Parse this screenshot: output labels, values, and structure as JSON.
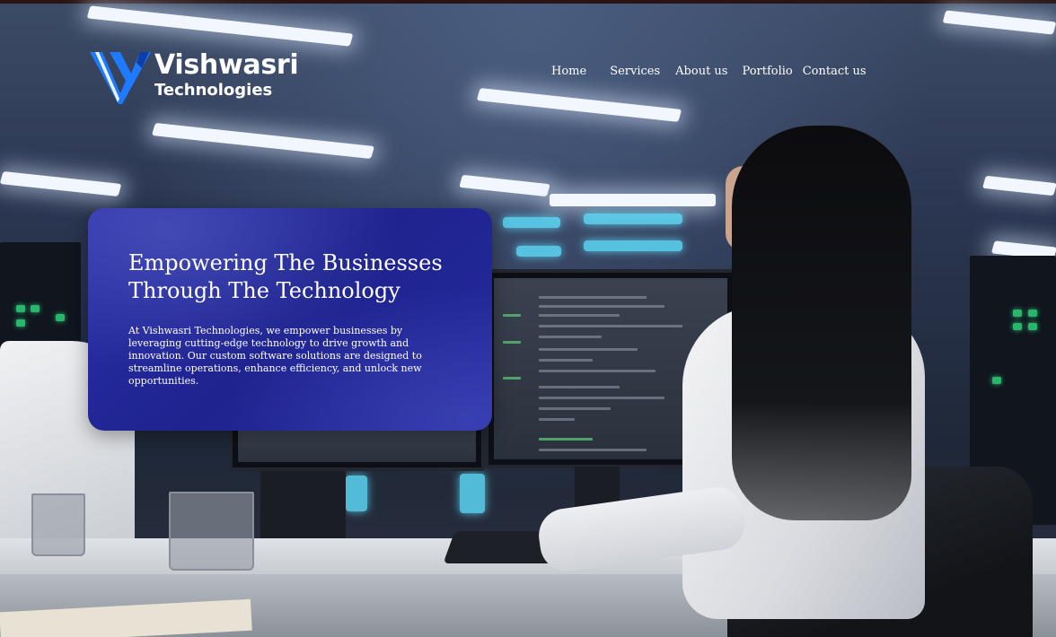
{
  "brand": {
    "name": "Vishwasri",
    "subtitle": "Technologies",
    "logo_icon": "v-logo-icon",
    "accent": "#1e7bff"
  },
  "nav": {
    "items": [
      {
        "label": "Home"
      },
      {
        "label": "Services"
      },
      {
        "label": "About us"
      },
      {
        "label": "Portfolio"
      },
      {
        "label": "Contact us"
      }
    ]
  },
  "hero": {
    "heading": "Empowering The Businesses Through The Technology",
    "body": "At Vishwasri Technologies, we empower businesses by leveraging cutting-edge technology to drive growth and innovation. Our custom software solutions are designed to streamline operations, enhance efficiency, and unlock new opportunities.",
    "card_color": "#2329a0"
  }
}
